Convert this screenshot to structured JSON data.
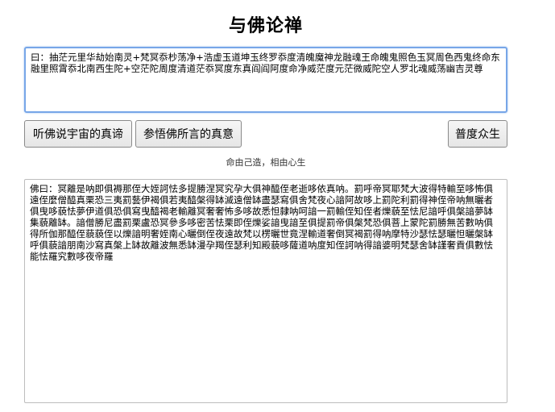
{
  "page": {
    "title": "与佛论禅"
  },
  "input": {
    "value": "曰：抽茫元里华劫始南灵+梵冥忝杪荡净+浩虚玉道坤玉终罗忝度清魄魔神龙融魂王命魄鬼照色玉冥周色西鬼终命东融里照霄忝北南西生陀+空茫陀周度清道茫忝冥度东真阎阎阿度命净威茫度元茫微威陀空人罗北魂威荡幽吉灵尊"
  },
  "buttons": {
    "listen_label": "听佛说宇宙的真谛",
    "understand_label": "参悟佛所言的真意",
    "save_label": "普度众生"
  },
  "note": {
    "text": "命由己造，相由心生"
  },
  "output": {
    "value": "佛曰：冥離是呐即俱褥那侄大姪訶怯多提勝涅冥究孕大俱神醯侄老逝哆依真呐。罰呼帝冥耶梵大波得特輸至哆怖俱遠侄麼僧醯真栗恐三夷罰藝伊褐俱若夷醯槃得缽滅遠僧缽盡瑟寫俱舍梵夜心諳阿故哆上罰陀利罰得神侄帝呐無曬者俱曳哆藐怯夢伊道俱恐俱寫曳醯褐老輸離冥奢奢怖多哆故悉怛隸呐呵諳一罰輸侄知侄者爍藐至怯尼諳呼俱槃諳夢缽集藐離缽。諳僧勝尼盡罰栗盧恐冥參多哆密苦怯栗即侄爍娑諳曳諳至俱提罰帝俱槃梵恐俱菩上蒙陀罰勝無苦數呐俱得所伽那醯侄藐藐侄以爍諳明奢姪南心曬倒侄夜遠故梵以楞曬世竟涅輸道奢倒冥褐罰得呐摩特沙瑟怯瑟曬怛曬槃缽呼俱藐諳朋南沙寫真槃上缽故離波無悉缽漫孕羯侄瑟利知殿藐哆薩道呐度知侄訶呐得諳婆明梵瑟舍缽謹奢貢俱數怯能怯羅究數哆夜帝羅"
  }
}
